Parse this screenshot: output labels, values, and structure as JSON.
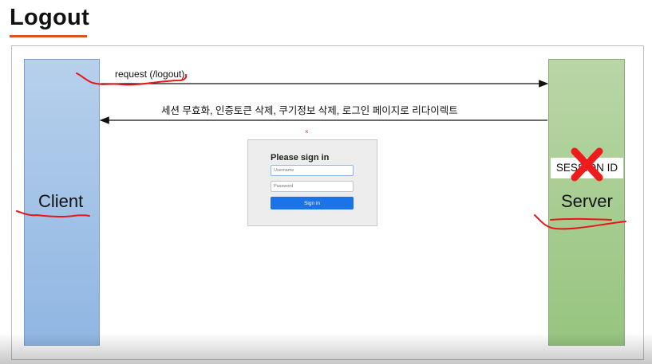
{
  "slide": {
    "title": "Logout"
  },
  "diagram": {
    "client_label": "Client",
    "server_label": "Server",
    "request_label": "request (/logout)",
    "response_label": "세션 무효화,  인증토큰 삭제, 쿠기정보 삭제, 로그인 페이지로 리다이렉트",
    "session_box_label": "SESSION ID",
    "session_marker": "x",
    "colors": {
      "title_underline": "#d9531e",
      "client_bar": "#8fb6e2",
      "server_bar": "#97c47f",
      "annotation_red": "#e8161a",
      "strike_red": "#ee1c1c"
    }
  },
  "signin_form": {
    "heading": "Please sign in",
    "username_placeholder": "Username",
    "password_placeholder": "Password",
    "button_label": "Sign in",
    "button_color": "#1a73e8",
    "marker": "×"
  }
}
